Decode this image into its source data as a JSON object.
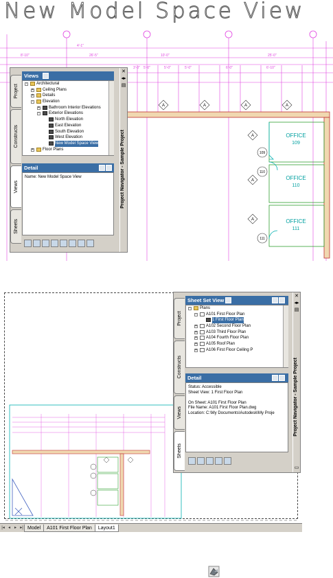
{
  "top_screenshot": {
    "title": "New Model Space View",
    "dimensions": [
      "4'-1\"",
      "8'-10\"",
      "26'-5\"",
      "10'-0\"",
      "3'-0\"",
      "5'-0\"",
      "5'-0\"",
      "5'-0\"",
      "6'-0\"",
      "6'-10\"",
      "25'-0\""
    ],
    "rooms": [
      {
        "name": "OFFICE",
        "number": "109"
      },
      {
        "name": "OFFICE",
        "number": "110"
      },
      {
        "name": "OFFICE",
        "number": "111"
      }
    ],
    "door_tags": [
      "109",
      "110",
      "111"
    ],
    "tag_letter": "A",
    "palette": {
      "title": "Project Navigator - Sample Project",
      "tabs": [
        "Project",
        "Constructs",
        "Views",
        "Sheets"
      ],
      "active_tab": "Views",
      "section_title": "Views",
      "tree": [
        {
          "label": "Architectural",
          "indent": 0,
          "pm": "-",
          "icon": "folder"
        },
        {
          "label": "Ceiling Plans",
          "indent": 1,
          "pm": "+",
          "icon": "folder"
        },
        {
          "label": "Details",
          "indent": 1,
          "pm": "+",
          "icon": "folder"
        },
        {
          "label": "Elevation",
          "indent": 1,
          "pm": "-",
          "icon": "folder"
        },
        {
          "label": "Bathroom Interior Elevations",
          "indent": 2,
          "pm": "+",
          "icon": "view"
        },
        {
          "label": "Exterior Elevations",
          "indent": 2,
          "pm": "-",
          "icon": "view"
        },
        {
          "label": "North Elevation",
          "indent": 3,
          "pm": "",
          "icon": "view"
        },
        {
          "label": "East Elevation",
          "indent": 3,
          "pm": "",
          "icon": "view"
        },
        {
          "label": "South Elevation",
          "indent": 3,
          "pm": "",
          "icon": "view"
        },
        {
          "label": "West Elevation",
          "indent": 3,
          "pm": "",
          "icon": "view"
        },
        {
          "label": "New Model Space View",
          "indent": 3,
          "pm": "",
          "icon": "view"
        },
        {
          "label": "Floor Plans",
          "indent": 1,
          "pm": "+",
          "icon": "folder"
        }
      ],
      "detail_title": "Detail",
      "detail_lines": [
        "Name: New Model Space View"
      ]
    }
  },
  "bottom_screenshot": {
    "palette": {
      "title": "Project Navigator - Sample Project",
      "tabs": [
        "Project",
        "Constructs",
        "Views",
        "Sheets"
      ],
      "active_tab": "Sheets",
      "section_title": "Sheet Set View",
      "tree": [
        {
          "label": "Plans",
          "indent": 0,
          "pm": "-",
          "icon": "folder"
        },
        {
          "label": "A101 First Floor Plan",
          "indent": 1,
          "pm": "-",
          "icon": "sheet"
        },
        {
          "label": "1 First Floor Plan",
          "indent": 2,
          "pm": "",
          "icon": "view"
        },
        {
          "label": "A102 Second Floor Plan",
          "indent": 1,
          "pm": "+",
          "icon": "sheet"
        },
        {
          "label": "A103 Third Floor Plan",
          "indent": 1,
          "pm": "+",
          "icon": "sheet"
        },
        {
          "label": "A104 Fourth Floor Plan",
          "indent": 1,
          "pm": "+",
          "icon": "sheet"
        },
        {
          "label": "A105 Roof Plan",
          "indent": 1,
          "pm": "+",
          "icon": "sheet"
        },
        {
          "label": "A106 First Floor Ceiling P",
          "indent": 1,
          "pm": "+",
          "icon": "sheet"
        }
      ],
      "detail_title": "Detail",
      "detail_lines": [
        "Status: Accessible",
        "Sheet View: 1 First Floor Plan",
        "",
        "On Sheet: A101 First Floor Plan",
        "File Name: A101 First Floor Plan.dwg",
        "Location: C:\\My Documents\\Autodesk\\My Proje"
      ]
    },
    "layout_tabs": [
      "Model",
      "A101 First Floor Plan",
      "Layout1"
    ],
    "active_layout_tab": "Layout1"
  },
  "colors": {
    "grid_line": "#e040e0",
    "wall": "#c03030",
    "accent_blue": "#3a6ea5",
    "cyan": "#00b0b0",
    "green": "#30a030"
  }
}
